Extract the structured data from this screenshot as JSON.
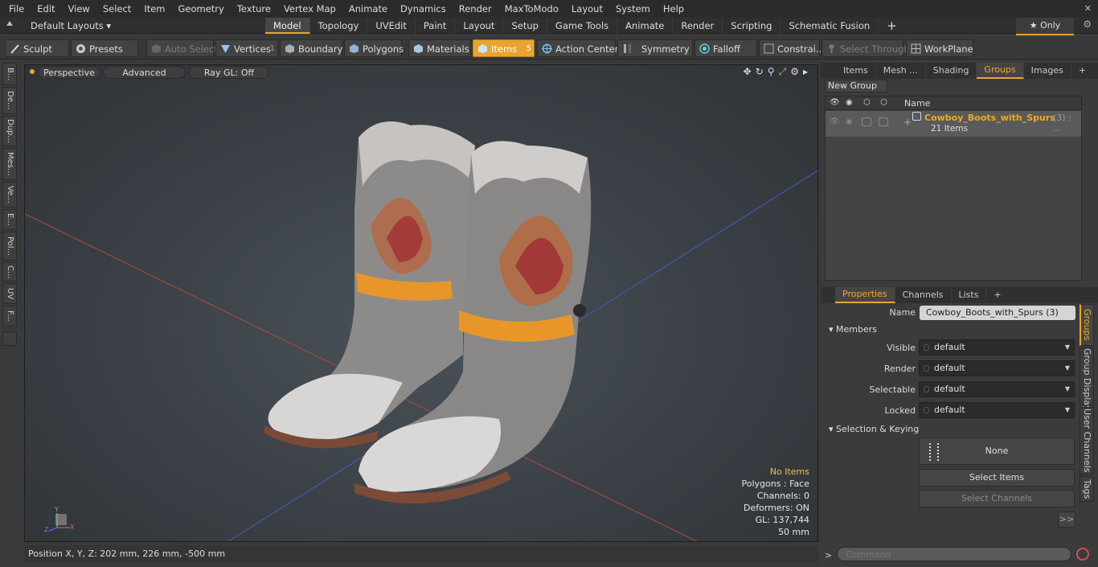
{
  "menubar": {
    "items": [
      "File",
      "Edit",
      "View",
      "Select",
      "Item",
      "Geometry",
      "Texture",
      "Vertex Map",
      "Animate",
      "Dynamics",
      "Render",
      "MaxToModo",
      "Layout",
      "System",
      "Help"
    ],
    "close_glyph": "✕"
  },
  "tabbar": {
    "layouts_label": "Default Layouts ▾",
    "tabs": [
      "Model",
      "Topology",
      "UVEdit",
      "Paint",
      "Layout",
      "Setup",
      "Game Tools",
      "Animate",
      "Render",
      "Scripting",
      "Schematic Fusion"
    ],
    "active_tab": "Model",
    "plus": "+",
    "only_label": "★ Only",
    "gear": "⚙"
  },
  "toolbar": {
    "sculpt": "Sculpt",
    "presets": "Presets",
    "auto_select": "Auto Select",
    "vertices": "Vertices",
    "vertices_count": "1",
    "boundary": "Boundary",
    "polygons": "Polygons",
    "materials": "Materials",
    "items": "Items",
    "items_count": "5",
    "action_center": "Action Center",
    "symmetry": "Symmetry",
    "falloff": "Falloff",
    "constraints": "Constrai...",
    "select_through": "Select Through",
    "workplane": "WorkPlane"
  },
  "left_tabs": [
    "B...",
    "De...",
    "Dup...",
    "Mes...",
    "Ve...",
    "E...",
    "Pol...",
    "C...",
    "UV",
    "F..."
  ],
  "viewport": {
    "perspective": "Perspective",
    "advanced": "Advanced",
    "raygl": "Ray GL: Off",
    "overlay": {
      "items": "No Items",
      "polygons": "Polygons : Face",
      "channels": "Channels: 0",
      "deformers": "Deformers: ON",
      "gl": "GL: 137,744",
      "scale": "50 mm"
    },
    "axis": {
      "x": "X",
      "y": "Y",
      "z": "Z"
    }
  },
  "statusbar": {
    "position": "Position X, Y, Z:   202 mm, 226 mm, -500 mm"
  },
  "groups_panel": {
    "tabs": [
      "Items",
      "Mesh ...",
      "Shading",
      "Groups",
      "Images"
    ],
    "active_tab": "Groups",
    "plus": "+",
    "new_group": "New Group",
    "col_name": "Name",
    "group_name": "Cowboy_Boots_with_Spurs",
    "group_suffix": "(3) : ...",
    "group_items": "21 Items"
  },
  "properties_panel": {
    "tabs": [
      "Properties",
      "Channels",
      "Lists"
    ],
    "active_tab": "Properties",
    "plus": "+",
    "name_label": "Name",
    "name_value": "Cowboy_Boots_with_Spurs (3)",
    "members_section": "Members",
    "visible_label": "Visible",
    "render_label": "Render",
    "selectable_label": "Selectable",
    "locked_label": "Locked",
    "default_value": "default",
    "selection_section": "Selection & Keying",
    "none_label": "None",
    "select_items": "Select Items",
    "select_channels": "Select Channels",
    "more": ">>",
    "side_tabs": [
      "Groups",
      "Group Display",
      "User Channels",
      "Tags"
    ]
  },
  "command": {
    "prompt": ">",
    "placeholder": "Command"
  },
  "colors": {
    "accent": "#e6a532",
    "boot_leather": "#a8a6a4",
    "strap": "#e8962a"
  }
}
